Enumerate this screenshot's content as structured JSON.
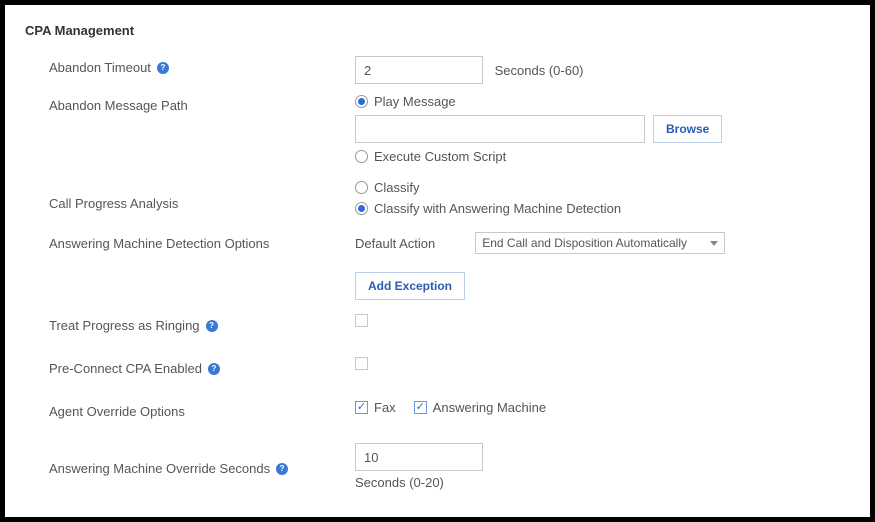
{
  "section": {
    "title": "CPA Management"
  },
  "abandonTimeout": {
    "label": "Abandon Timeout",
    "value": "2",
    "suffix": "Seconds (0-60)"
  },
  "abandonMessagePath": {
    "label": "Abandon Message Path",
    "playMessage": "Play Message",
    "pathValue": "",
    "browse": "Browse",
    "executeCustomScript": "Execute Custom Script"
  },
  "callProgress": {
    "label": "Call Progress Analysis",
    "classify": "Classify",
    "classifyAmd": "Classify with Answering Machine Detection"
  },
  "amdOptions": {
    "label": "Answering Machine Detection Options",
    "defaultActionLabel": "Default Action",
    "defaultActionValue": "End Call and Disposition Automatically",
    "addException": "Add Exception"
  },
  "treatProgress": {
    "label": "Treat Progress as Ringing"
  },
  "preConnect": {
    "label": "Pre-Connect CPA Enabled"
  },
  "agentOverride": {
    "label": "Agent Override Options",
    "fax": "Fax",
    "answeringMachine": "Answering Machine"
  },
  "amOverrideSeconds": {
    "label": "Answering Machine Override Seconds",
    "value": "10",
    "suffix": "Seconds (0-20)"
  }
}
